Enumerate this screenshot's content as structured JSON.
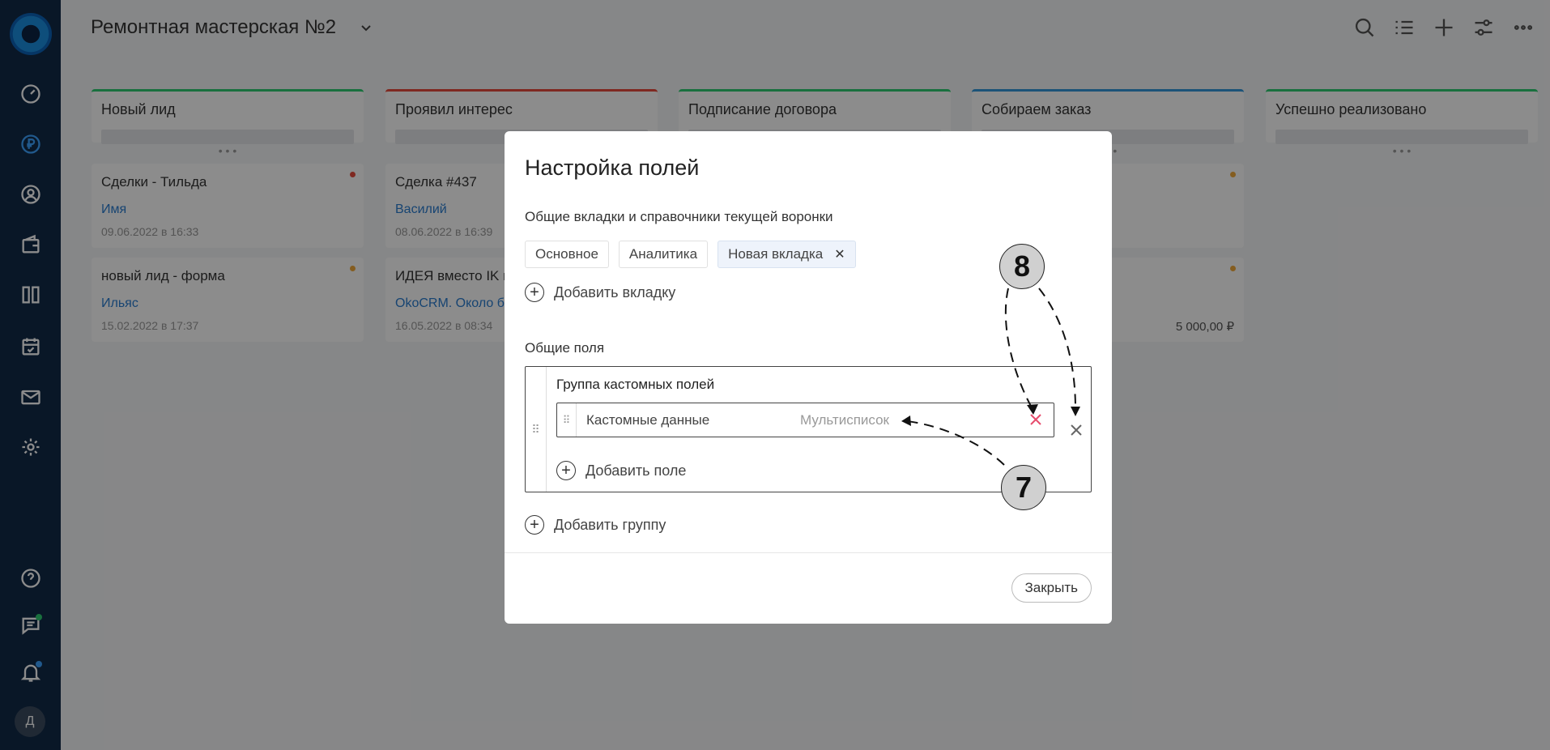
{
  "header": {
    "title": "Ремонтная мастерская №2"
  },
  "user": {
    "initial": "Д"
  },
  "columns": [
    {
      "title": "Новый лид",
      "color": "#2ecc71",
      "cards": [
        {
          "title": "Сделки - Тильда",
          "link": "Имя",
          "date": "09.06.2022 в 16:33",
          "dot": "#e74c3c",
          "amount": ""
        },
        {
          "title": "новый лид - форма",
          "link": "Ильяс",
          "date": "15.02.2022 в 17:37",
          "dot": "#f0a93b",
          "amount": ""
        }
      ]
    },
    {
      "title": "Проявил интерес",
      "color": "#e74c3c",
      "cards": [
        {
          "title": "Сделка #437",
          "link": "Василий",
          "date": "08.06.2022 в 16:39",
          "dot": "",
          "amount": ""
        },
        {
          "title": "ИДЕЯ вместо IK шумок угнать и",
          "link": "OkoCRM. Около б",
          "date": "16.05.2022 в 08:34",
          "dot": "",
          "amount": ""
        }
      ]
    },
    {
      "title": "Подписание договора",
      "color": "#2ecc71",
      "cards": []
    },
    {
      "title": "Собираем заказ",
      "color": "#3498db",
      "cards": [
        {
          "title": "",
          "link": "",
          "date": "",
          "dot": "#f0a93b",
          "amount": ""
        },
        {
          "title": "",
          "link": "",
          "date": "",
          "dot": "#f0a93b",
          "amount": "5 000,00 ₽"
        }
      ]
    },
    {
      "title": "Успешно реализовано",
      "color": "#2ecc71",
      "cards": []
    }
  ],
  "modal": {
    "title": "Настройка полей",
    "subtitle": "Общие вкладки и справочники текущей воронки",
    "tabs": [
      "Основное",
      "Аналитика",
      "Новая вкладка"
    ],
    "add_tab": "Добавить вкладку",
    "section_title": "Общие поля",
    "group_title": "Группа кастомных полей",
    "field_name": "Кастомные данные",
    "field_type": "Мультисписок",
    "add_field": "Добавить поле",
    "add_group": "Добавить группу",
    "close_label": "Закрыть"
  },
  "annotations": {
    "badge_8": "8",
    "badge_7": "7"
  },
  "icons": [
    "logo",
    "dashboard-icon",
    "ruble-icon",
    "contacts-icon",
    "wallet-icon",
    "board-icon",
    "calendar-icon",
    "mail-icon",
    "settings-icon",
    "help-icon",
    "chat-icon",
    "bell-icon",
    "search-icon",
    "list-icon",
    "plus-icon",
    "filter-icon",
    "more-icon"
  ]
}
